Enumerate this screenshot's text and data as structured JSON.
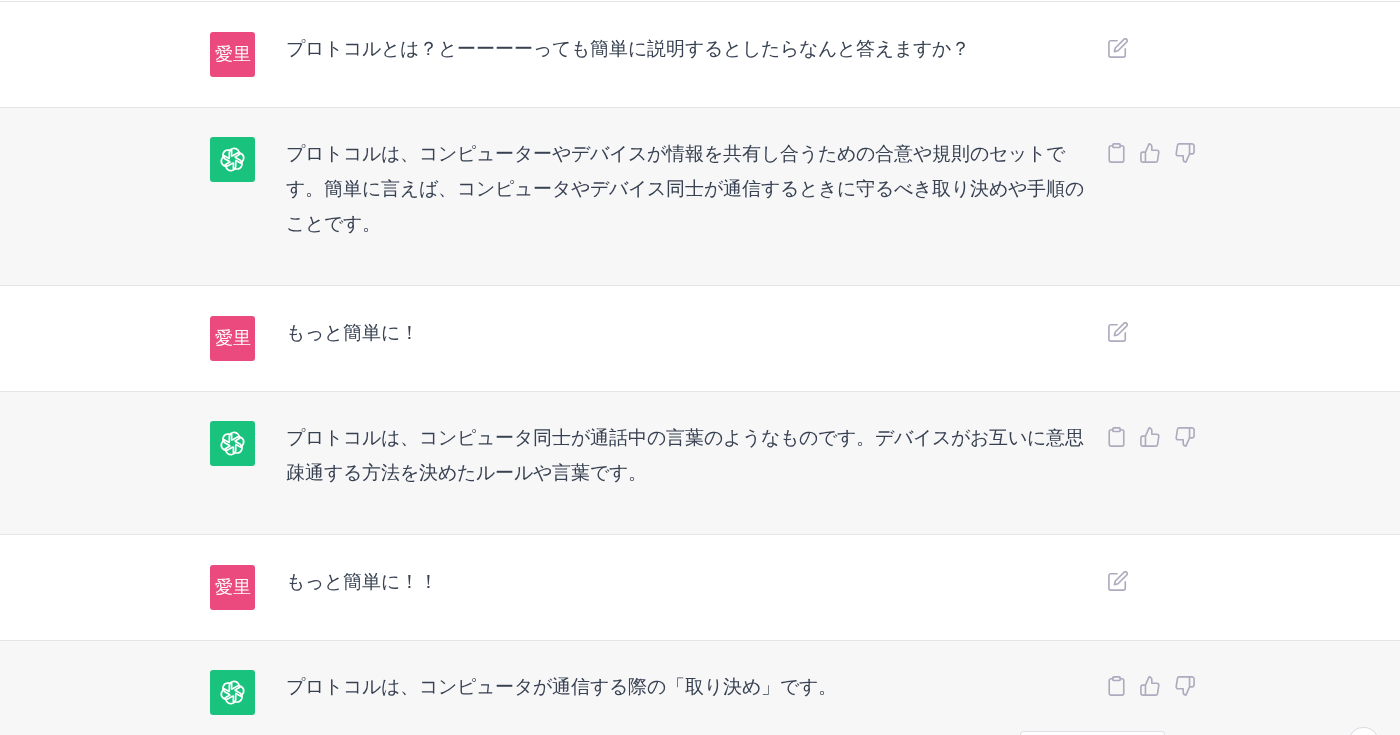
{
  "messages": [
    {
      "kind": "user",
      "avatar_text": "愛里",
      "text": "プロトコルとは？とーーーーっても簡単に説明するとしたらなんと答えますか？"
    },
    {
      "kind": "assistant",
      "text": "プロトコルは、コンピューターやデバイスが情報を共有し合うための合意や規則のセットです。簡単に言えば、コンピュータやデバイス同士が通信するときに守るべき取り決めや手順のことです。"
    },
    {
      "kind": "user",
      "avatar_text": "愛里",
      "text": "もっと簡単に！"
    },
    {
      "kind": "assistant",
      "text": "プロトコルは、コンピュータ同士が通話中の言葉のようなものです。デバイスがお互いに意思疎通する方法を決めたルールや言葉です。"
    },
    {
      "kind": "user",
      "avatar_text": "愛里",
      "text": "もっと簡単に！！"
    },
    {
      "kind": "assistant",
      "text": "プロトコルは、コンピュータが通信する際の「取り決め」です。"
    }
  ]
}
